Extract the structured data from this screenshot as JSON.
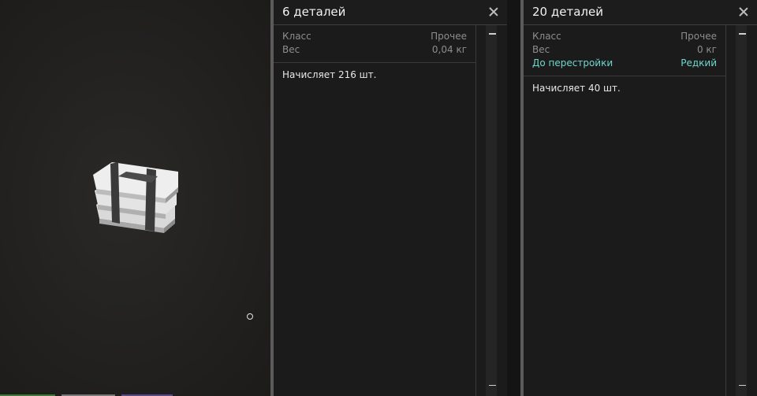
{
  "preview": {
    "item_icon": "bundle-of-parts-icon"
  },
  "panels": [
    {
      "title": "6 деталей",
      "props": [
        {
          "key": "Класс",
          "value": "Прочее"
        },
        {
          "key": "Вес",
          "value": "0,04 кг"
        }
      ],
      "description": "Начисляет 216 шт."
    },
    {
      "title": "20 деталей",
      "props": [
        {
          "key": "Класс",
          "value": "Прочее"
        },
        {
          "key": "Вес",
          "value": "0 кг"
        },
        {
          "key": "До перестройки",
          "value": "Редкий"
        }
      ],
      "description": "Начисляет 40 шт."
    }
  ],
  "colors": {
    "accent": "#6fd6cc",
    "panel_bg": "#1b1b1b",
    "preview_bg": "#222120"
  }
}
